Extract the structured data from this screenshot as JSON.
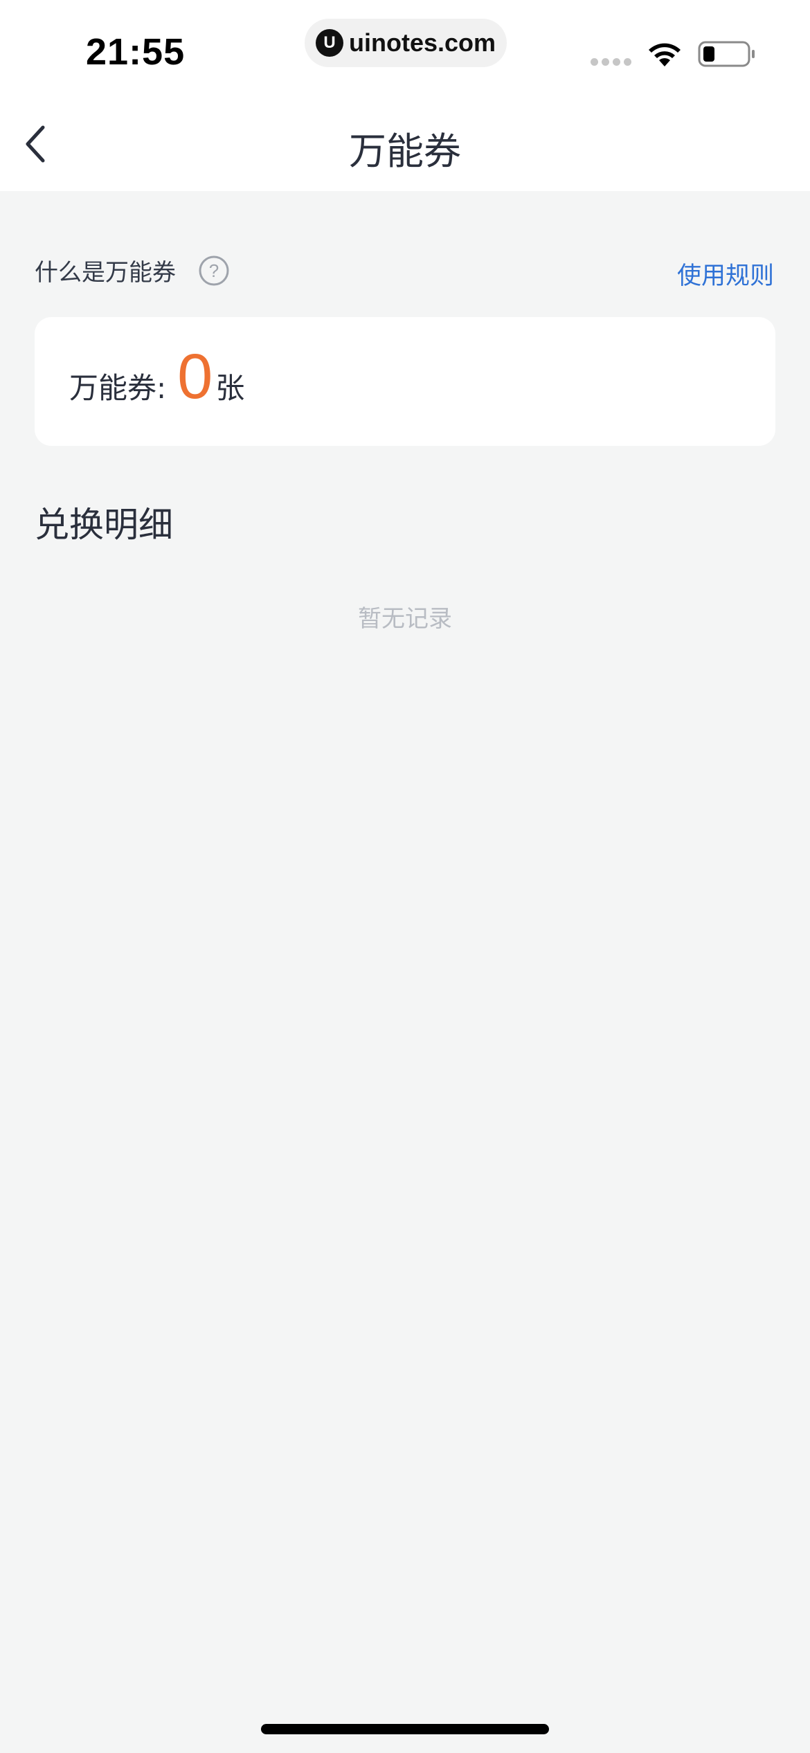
{
  "status_bar": {
    "time": "21:55",
    "url": "uinotes.com",
    "url_logo": "U"
  },
  "nav": {
    "back_icon": "chevron-left-icon",
    "title": "万能券"
  },
  "info": {
    "what_label": "什么是万能券",
    "help_icon": "question-circle-icon",
    "rules_link": "使用规则"
  },
  "card": {
    "label": "万能券:",
    "count": "0",
    "unit": "张"
  },
  "history": {
    "title": "兑换明细",
    "empty_text": "暂无记录"
  },
  "colors": {
    "accent_orange": "#ee7131",
    "link_blue": "#2f72d6",
    "background": "#f4f5f5",
    "text_dark": "#2a2f3c",
    "text_muted": "#b8bcc3"
  }
}
